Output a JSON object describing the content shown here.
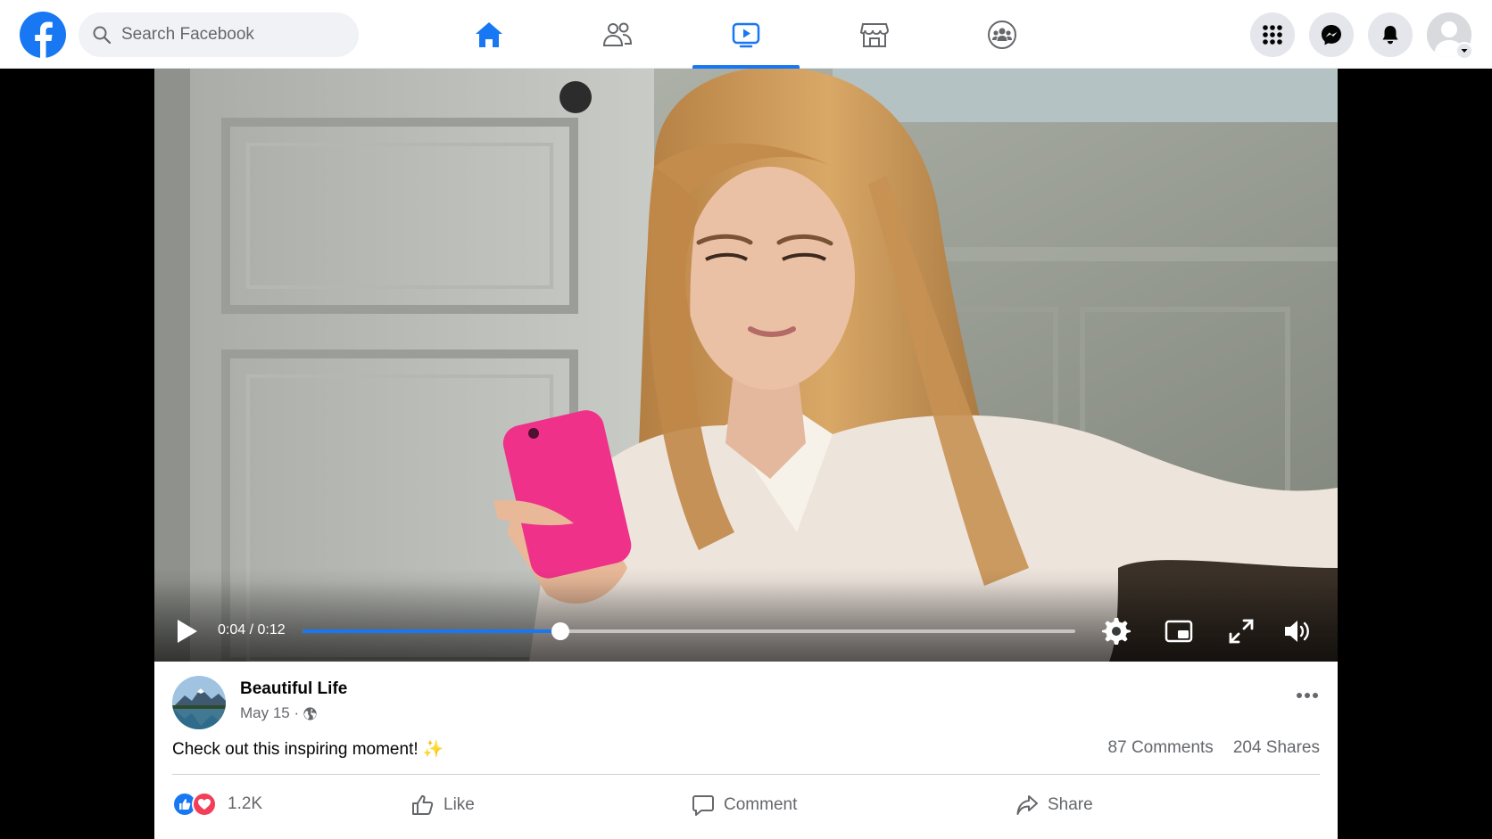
{
  "header": {
    "logo_icon": "facebook-logo",
    "search": {
      "placeholder": "Search Facebook",
      "value": ""
    },
    "nav_tabs": [
      {
        "name": "Home",
        "icon": "home-icon"
      },
      {
        "name": "Friends",
        "icon": "friends-icon"
      },
      {
        "name": "Watch",
        "icon": "watch-icon",
        "active": true
      },
      {
        "name": "Marketplace",
        "icon": "marketplace-icon"
      },
      {
        "name": "Groups",
        "icon": "groups-icon"
      }
    ],
    "right_buttons": [
      "menu-grid-icon",
      "messenger-icon",
      "notifications-bell-icon",
      "account-avatar"
    ]
  },
  "video": {
    "time": "0:04 / 0:12",
    "progress_fraction": 0.3333,
    "controls": [
      "play-icon",
      "settings-gear-icon",
      "picture-in-picture-icon",
      "fullscreen-icon",
      "volume-icon"
    ]
  },
  "post": {
    "page_name": "Beautiful Life",
    "date": "May 15 ·",
    "audience_icon": "globe-icon",
    "caption": "Check out this inspiring moment! ✨",
    "comments": "87 Comments",
    "shares": "204 Shares",
    "reactions_count": "1.2K",
    "actions": {
      "like": "Like",
      "comment": "Comment",
      "share": "Share"
    }
  },
  "colors": {
    "brand_blue": "#1877f2",
    "love_red": "#f33e58",
    "secondary_text": "#65676b"
  }
}
